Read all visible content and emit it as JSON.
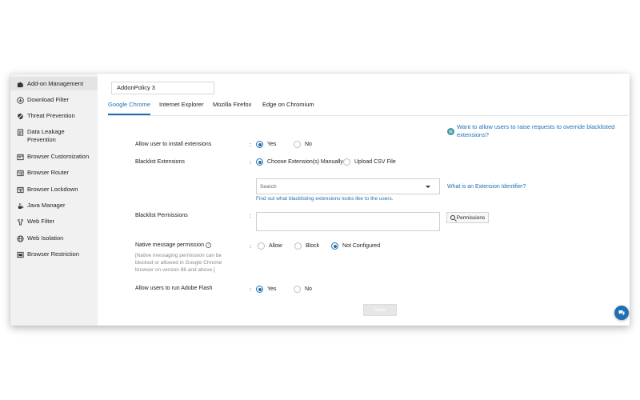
{
  "sidebar": {
    "items": [
      {
        "label": "Add-on Management",
        "icon": "puzzle-icon",
        "active": true
      },
      {
        "label": "Download Filter",
        "icon": "download-icon"
      },
      {
        "label": "Threat Prevention",
        "icon": "shield-off-icon"
      },
      {
        "label": "Data Leakage Prevention",
        "icon": "data-leak-icon"
      },
      {
        "label": "Browser Customization",
        "icon": "browser-window-icon"
      },
      {
        "label": "Browser Router",
        "icon": "router-icon"
      },
      {
        "label": "Browser Lockdown",
        "icon": "lock-window-icon"
      },
      {
        "label": "Java Manager",
        "icon": "java-cup-icon"
      },
      {
        "label": "Web Filter",
        "icon": "filter-icon"
      },
      {
        "label": "Web Isolation",
        "icon": "globe-icon"
      },
      {
        "label": "Browser Restriction",
        "icon": "restriction-icon"
      }
    ]
  },
  "policy": {
    "name": "AddonPolicy 3"
  },
  "tabs": [
    {
      "label": "Google Chrome",
      "active": true
    },
    {
      "label": "Internet Explorer"
    },
    {
      "label": "Mozilla Firefox"
    },
    {
      "label": "Edge on Chromium"
    }
  ],
  "help_link": "Want to allow users to raise requests to override blacklisted extensions?",
  "form": {
    "allow_install": {
      "label": "Allow user to install extensions",
      "options": [
        "Yes",
        "No"
      ],
      "selected": "Yes"
    },
    "blacklist_ext": {
      "label": "Blacklist Extensions",
      "options": [
        "Choose Extension(s) Manually",
        "Upload CSV File"
      ],
      "selected": "Choose Extension(s) Manually",
      "search_placeholder": "Search",
      "find_out_link": "Find out what blacklisting extensions looks like to the users.",
      "identifier_link": "What is an Extension Identifier?"
    },
    "blacklist_perm": {
      "label": "Blacklist Permissions",
      "button": "Permissions"
    },
    "native_msg": {
      "label": "Native message permission",
      "note": "[Native messaging permission can be blocked or allowed in Google Chrome browser on version 86 and above.]",
      "options": [
        "Allow",
        "Block",
        "Not Configured"
      ],
      "selected": "Not Configured"
    },
    "adobe_flash": {
      "label": "Allow users to run Adobe Flash",
      "options": [
        "Yes",
        "No"
      ],
      "selected": "Yes"
    },
    "colon": ":"
  },
  "save_label": "Save",
  "colors": {
    "accent": "#1f6fb2",
    "sidebar_bg": "#f1f1f1"
  }
}
